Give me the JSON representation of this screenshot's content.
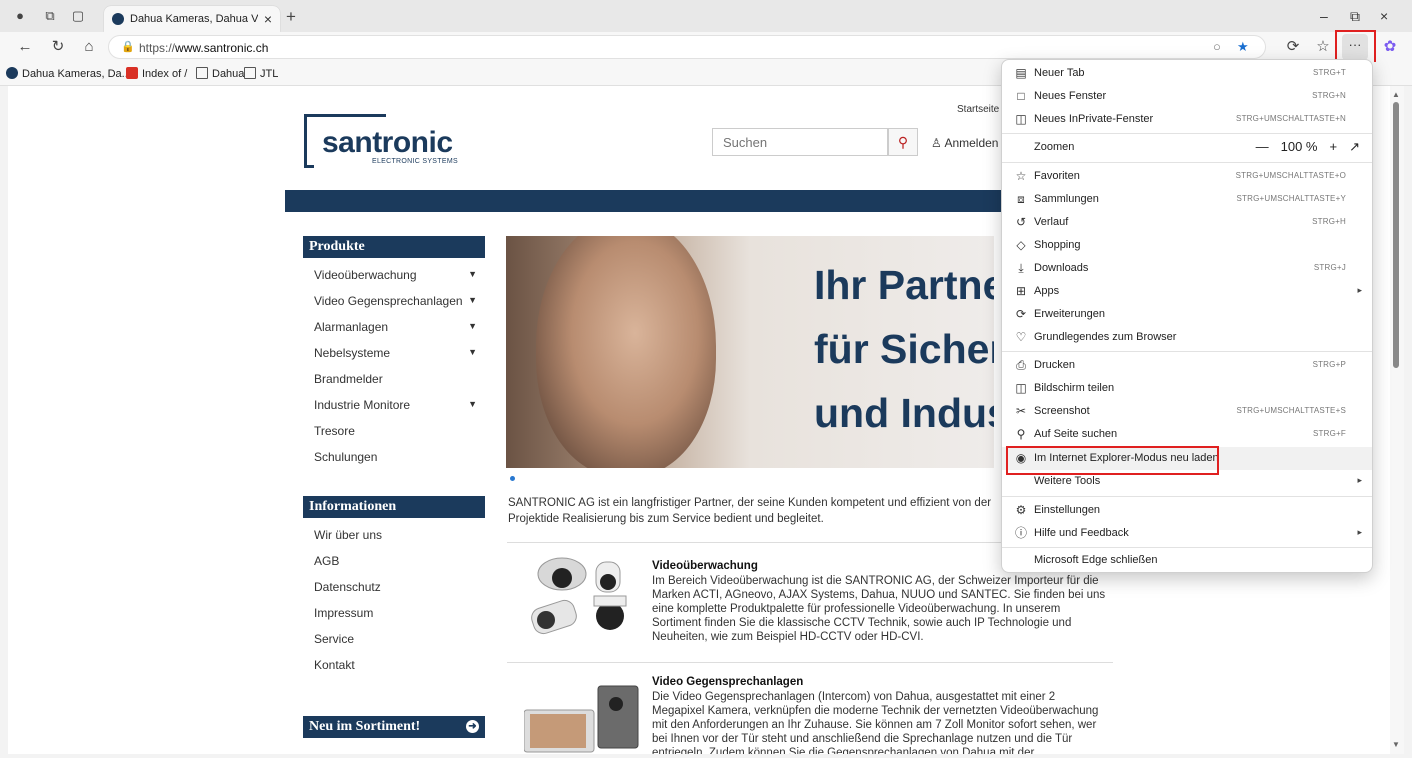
{
  "browser": {
    "tab_title": "Dahua Kameras, Dahua Videoübe",
    "url_prefix": "https://",
    "url_domain": "www.santronic.ch",
    "bookmarks": [
      "Dahua Kameras, Da...",
      "Index of /",
      "Dahua",
      "JTL"
    ]
  },
  "site": {
    "top_link": "Startseite",
    "logo_main": "santronic",
    "logo_sub": "ELECTRONIC SYSTEMS",
    "search_placeholder": "Suchen",
    "login": "Anmelden",
    "products_head": "Produkte",
    "products": [
      {
        "label": "Videoüberwachung",
        "caret": true
      },
      {
        "label": "Video Gegensprechanlagen",
        "caret": true
      },
      {
        "label": "Alarmanlagen",
        "caret": true
      },
      {
        "label": "Nebelsysteme",
        "caret": true
      },
      {
        "label": "Brandmelder",
        "caret": false
      },
      {
        "label": "Industrie Monitore",
        "caret": true
      },
      {
        "label": "Tresore",
        "caret": false
      },
      {
        "label": "Schulungen",
        "caret": false
      }
    ],
    "info_head": "Informationen",
    "info": [
      "Wir über uns",
      "AGB",
      "Datenschutz",
      "Impressum",
      "Service",
      "Kontakt"
    ],
    "new_head": "Neu im Sortiment!",
    "hero_lines": [
      "Ihr Partne",
      "für Sicherl",
      "und Indus"
    ],
    "intro": "SANTRONIC AG ist ein langfristiger Partner, der seine Kunden kompetent und effizient von der Projektide Realisierung bis zum Service bedient und begleitet.",
    "p1_title": "Videoüberwachung",
    "p1_text": "Im Bereich Videoüberwachung ist die SANTRONIC AG, der Schweizer Importeur für die Marken ACTI, AGneovo, AJAX Systems, Dahua, NUUO und SANTEC. Sie finden bei uns eine komplette Produktpalette für professionelle Videoüberwachung. In unserem Sortiment finden Sie die klassische CCTV Technik, sowie auch IP Technologie und Neuheiten, wie zum Beispiel HD-CCTV oder HD-CVI.",
    "p2_title": "Video Gegensprechanlagen",
    "p2_text": "Die Video Gegensprechanlagen (Intercom) von Dahua, ausgestattet mit einer 2 Megapixel Kamera, verknüpfen die moderne Technik der vernetzten Videoüberwachung mit den Anforderungen an Ihr Zuhause. Sie können am 7 Zoll Monitor sofort sehen, wer bei Ihnen vor der Tür steht und anschließend die Sprechanlage nutzen und die Tür entriegeln. Zudem können Sie die Gegensprechanlagen von Dahua mit der Videoüberwachungsanlage verknüpfen."
  },
  "menu": {
    "new_tab": {
      "label": "Neuer Tab",
      "key": "STRG+T"
    },
    "new_window": {
      "label": "Neues Fenster",
      "key": "STRG+N"
    },
    "inprivate": {
      "label": "Neues InPrivate-Fenster",
      "key": "STRG+UMSCHALTTASTE+N"
    },
    "zoom": {
      "label": "Zoomen",
      "value": "100 %"
    },
    "favorites": {
      "label": "Favoriten",
      "key": "STRG+UMSCHALTTASTE+O"
    },
    "collections": {
      "label": "Sammlungen",
      "key": "STRG+UMSCHALTTASTE+Y"
    },
    "history": {
      "label": "Verlauf",
      "key": "STRG+H"
    },
    "shopping": {
      "label": "Shopping"
    },
    "downloads": {
      "label": "Downloads",
      "key": "STRG+J"
    },
    "apps": {
      "label": "Apps"
    },
    "extensions": {
      "label": "Erweiterungen"
    },
    "essentials": {
      "label": "Grundlegendes zum Browser"
    },
    "print": {
      "label": "Drucken",
      "key": "STRG+P"
    },
    "share": {
      "label": "Bildschirm teilen"
    },
    "screenshot": {
      "label": "Screenshot",
      "key": "STRG+UMSCHALTTASTE+S"
    },
    "find": {
      "label": "Auf Seite suchen",
      "key": "STRG+F"
    },
    "ie_mode": {
      "label": "Im Internet Explorer-Modus neu laden"
    },
    "more_tools": {
      "label": "Weitere Tools"
    },
    "settings": {
      "label": "Einstellungen"
    },
    "help": {
      "label": "Hilfe und Feedback"
    },
    "close": {
      "label": "Microsoft Edge schließen"
    }
  },
  "colors": {
    "brand": "#1b3a5c",
    "highlight": "#e02020"
  }
}
